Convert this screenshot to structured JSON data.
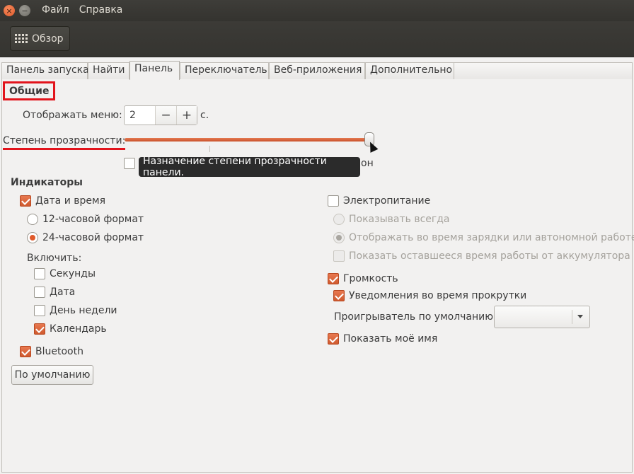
{
  "menu": {
    "file": "Файл",
    "help": "Справка"
  },
  "toolbar": {
    "overview": "Обзор"
  },
  "tabs": [
    "Панель запуска",
    "Найти",
    "Панель",
    "Переключатель",
    "Веб-приложения",
    "Дополнительно"
  ],
  "active_tab": "Панель",
  "general": {
    "section_title": "Общие",
    "show_menu_label": "Отображать меню:",
    "show_menu_value": "2",
    "show_menu_unit": "с.",
    "spin_minus": "−",
    "spin_plus": "+",
    "transparency_label": "Степень прозрачности:",
    "transparency_fraction": 0.98,
    "hidden_checkbox_tail": "он",
    "tooltip": "Назначение степени прозрачности панели."
  },
  "indicators": {
    "title": "Индикаторы",
    "datetime": {
      "label": "Дата и время",
      "checked": true,
      "format_12": "12-часовой формат",
      "format_24": "24-часовой формат",
      "selected": "24",
      "include_label": "Включить:",
      "seconds": "Секунды",
      "date": "Дата",
      "weekday": "День недели",
      "calendar": "Календарь"
    },
    "bluetooth": "Bluetooth",
    "power": {
      "label": "Электропитание",
      "show_always": "Показывать всегда",
      "show_charging": "Отображать во время зарядки или автономной работе",
      "show_remaining": "Показать оставшееся время работы от аккумулятора"
    },
    "sound": {
      "label": "Громкость",
      "scroll_notify": "Уведомления во время прокрутки",
      "default_player_label": "Проигрыватель по умолчанию:",
      "default_player_value": ""
    },
    "show_name": "Показать моё имя"
  },
  "reset_button": "По умолчанию",
  "colors": {
    "accent": "#e05a2b",
    "highlight": "#e2141c",
    "titlebar": "#3c3b37"
  },
  "icons": {
    "close": "close-icon",
    "minimize": "minimize-icon",
    "overview": "grid-icon"
  }
}
